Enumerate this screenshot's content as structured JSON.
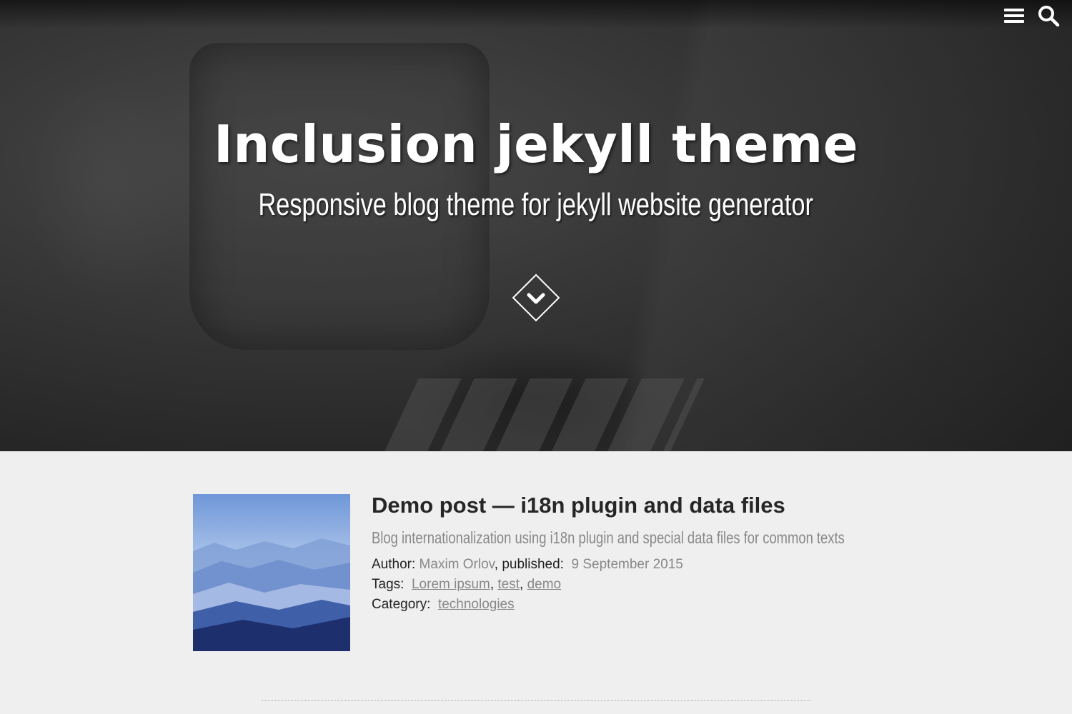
{
  "header": {
    "title": "Inclusion jekyll theme",
    "subtitle": "Responsive blog theme for jekyll website generator",
    "icons": [
      "menu-icon",
      "search-icon",
      "chevron-down-icon"
    ]
  },
  "post": {
    "title": "Demo post — i18n plugin and data files",
    "description": "Blog internationalization using i18n plugin and special data files for common texts",
    "author_label": "Author:",
    "author": "Maxim Orlov",
    "published_label": ", published:",
    "date": "9 September 2015",
    "tags_label": "Tags:",
    "tags": [
      "Lorem ipsum",
      "test",
      "demo"
    ],
    "category_label": "Category:",
    "category": "technologies"
  },
  "separator": ","
}
